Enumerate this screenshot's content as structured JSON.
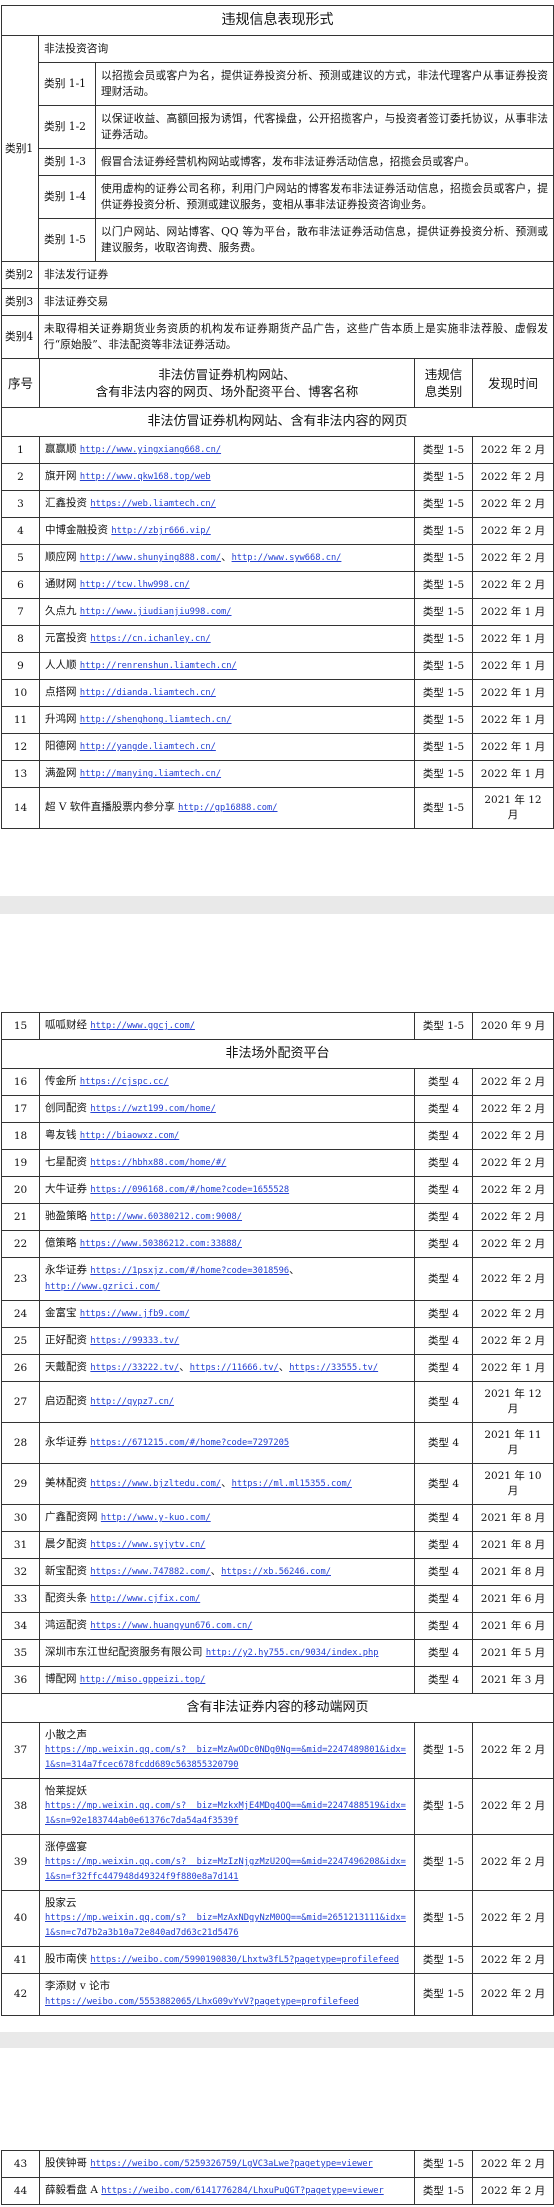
{
  "colors": {
    "link": "#2440d2",
    "border": "#333333",
    "page_gap": "#e9e9e9"
  },
  "forms_table": {
    "title": "违规信息表现形式",
    "category1": {
      "label": "类别1",
      "heading": "非法投资咨询",
      "items": [
        {
          "code": "类别 1-1",
          "desc": "以招揽会员或客户为名，提供证券投资分析、预测或建议的方式，非法代理客户从事证券投资理财活动。"
        },
        {
          "code": "类别 1-2",
          "desc": "以保证收益、高额回报为诱饵，代客操盘，公开招揽客户，与投资者签订委托协议，从事非法证券活动。"
        },
        {
          "code": "类别 1-3",
          "desc": "假冒合法证券经营机构网站或博客，发布非法证券活动信息，招揽会员或客户。"
        },
        {
          "code": "类别 1-4",
          "desc": "使用虚构的证券公司名称，利用门户网站的博客发布非法证券活动信息，招揽会员或客户，提供证券投资分析、预测或建议服务，变相从事非法证券投资咨询业务。"
        },
        {
          "code": "类别 1-5",
          "desc": "以门户网站、网站博客、QQ 等为平台，散布非法证券活动信息，提供证券投资分析、预测或建议服务，收取咨询费、服务费。"
        }
      ]
    },
    "others": [
      {
        "label": "类别2",
        "desc": "非法发行证券"
      },
      {
        "label": "类别3",
        "desc": "非法证券交易"
      },
      {
        "label": "类别4",
        "desc": "未取得相关证券期货业务资质的机构发布证券期货产品广告，这些广告本质上是实施非法荐股、虚假发行“原始股”、非法配资等非法证券活动。"
      }
    ]
  },
  "list_table": {
    "headers": {
      "no": "序号",
      "name_lines": [
        "非法仿冒证券机构网站、",
        "含有非法内容的网页、场外配资平台、博客名称"
      ],
      "category": "违规信息类别",
      "date": "发现时间"
    },
    "link_separator": "、",
    "sections": [
      {
        "title": "非法仿冒证券机构网站、含有非法内容的网页",
        "rows": [
          {
            "no": "1",
            "name": "赢赢顺",
            "links": [
              "http://www.yingxiang668.cn/"
            ],
            "category": "类型 1-5",
            "date": "2022 年 2 月"
          },
          {
            "no": "2",
            "name": "旗开网",
            "links": [
              "http://www.qkw168.top/web"
            ],
            "category": "类型 1-5",
            "date": "2022 年 2 月"
          },
          {
            "no": "3",
            "name": "汇鑫投资",
            "links": [
              "https://web.liamtech.cn/"
            ],
            "category": "类型 1-5",
            "date": "2022 年 2 月"
          },
          {
            "no": "4",
            "name": "中博金融投资",
            "links": [
              "http://zbjr666.vip/"
            ],
            "category": "类型 1-5",
            "date": "2022 年 2 月"
          },
          {
            "no": "5",
            "name": "顺应网",
            "links": [
              "http://www.shunying888.com/",
              "http://www.syw668.cn/"
            ],
            "category": "类型 1-5",
            "date": "2022 年 2 月"
          },
          {
            "no": "6",
            "name": "通财网",
            "links": [
              "http://tcw.lhw998.cn/"
            ],
            "category": "类型 1-5",
            "date": "2022 年 2 月"
          },
          {
            "no": "7",
            "name": "久点九",
            "links": [
              "http://www.jiudianjiu998.com/"
            ],
            "category": "类型 1-5",
            "date": "2022 年 1 月"
          },
          {
            "no": "8",
            "name": "元富投资",
            "links": [
              "https://cn.ichanley.cn/"
            ],
            "category": "类型 1-5",
            "date": "2022 年 1 月"
          },
          {
            "no": "9",
            "name": "人人顺",
            "links": [
              "http://renrenshun.liamtech.cn/"
            ],
            "category": "类型 1-5",
            "date": "2022 年 1 月"
          },
          {
            "no": "10",
            "name": "点搭网",
            "links": [
              "http://dianda.liamtech.cn/"
            ],
            "category": "类型 1-5",
            "date": "2022 年 1 月"
          },
          {
            "no": "11",
            "name": "升鸿网",
            "links": [
              "http://shenghong.liamtech.cn/"
            ],
            "category": "类型 1-5",
            "date": "2022 年 1 月"
          },
          {
            "no": "12",
            "name": "阳德网",
            "links": [
              "http://yangde.liamtech.cn/"
            ],
            "category": "类型 1-5",
            "date": "2022 年 1 月"
          },
          {
            "no": "13",
            "name": "满盈网",
            "links": [
              "http://manying.liamtech.cn/"
            ],
            "category": "类型 1-5",
            "date": "2022 年 1 月"
          },
          {
            "no": "14",
            "name": "超 V 软件直播股票内参分享",
            "links": [
              "http://gp16888.com/"
            ],
            "category": "类型 1-5",
            "date": "2021 年 12 月"
          },
          {
            "no": "15",
            "name": "呱呱财经",
            "links": [
              "http://www.ggcj.com/"
            ],
            "category": "类型 1-5",
            "date": "2020 年 9 月"
          }
        ]
      },
      {
        "title": "非法场外配资平台",
        "rows": [
          {
            "no": "16",
            "name": "传金所",
            "links": [
              "https://cjspc.cc/"
            ],
            "category": "类型 4",
            "date": "2022 年 2 月"
          },
          {
            "no": "17",
            "name": "创同配资",
            "links": [
              "https://wzt199.com/home/"
            ],
            "category": "类型 4",
            "date": "2022 年 2 月"
          },
          {
            "no": "18",
            "name": "粤友钱",
            "links": [
              "http://biaowxz.com/"
            ],
            "category": "类型 4",
            "date": "2022 年 2 月"
          },
          {
            "no": "19",
            "name": "七星配资",
            "links": [
              "https://hbhx88.com/home/#/"
            ],
            "category": "类型 4",
            "date": "2022 年 2 月"
          },
          {
            "no": "20",
            "name": "大牛证券",
            "links": [
              "https://096168.com/#/home?code=1655528"
            ],
            "category": "类型 4",
            "date": "2022 年 2 月"
          },
          {
            "no": "21",
            "name": "驰盈策略",
            "links": [
              "http://www.60380212.com:9008/"
            ],
            "category": "类型 4",
            "date": "2022 年 2 月"
          },
          {
            "no": "22",
            "name": "億策略",
            "links": [
              "https://www.50386212.com:33888/"
            ],
            "category": "类型 4",
            "date": "2022 年 2 月"
          },
          {
            "no": "23",
            "name": "永华证券",
            "links": [
              "https://1psxjz.com/#/home?code=3018596",
              "http://www.gzrici.com/"
            ],
            "category": "类型 4",
            "date": "2022 年 2 月"
          },
          {
            "no": "24",
            "name": "金富宝",
            "links": [
              "https://www.jfb9.com/"
            ],
            "category": "类型 4",
            "date": "2022 年 2 月"
          },
          {
            "no": "25",
            "name": "正好配资",
            "links": [
              "https://99333.tv/"
            ],
            "category": "类型 4",
            "date": "2022 年 2 月"
          },
          {
            "no": "26",
            "name": "天戴配资",
            "links": [
              "https://33222.tv/",
              "https://11666.tv/",
              "https://33555.tv/"
            ],
            "category": "类型 4",
            "date": "2022 年 1 月"
          },
          {
            "no": "27",
            "name": "启迈配资",
            "links": [
              "http://qypz7.cn/"
            ],
            "category": "类型 4",
            "date": "2021 年 12 月"
          },
          {
            "no": "28",
            "name": "永华证券",
            "links": [
              "https://671215.com/#/home?code=7297205"
            ],
            "category": "类型 4",
            "date": "2021 年 11 月"
          },
          {
            "no": "29",
            "name": "美林配资",
            "links": [
              "https://www.bjzltedu.com/",
              "https://ml.ml15355.com/"
            ],
            "category": "类型 4",
            "date": "2021 年 10 月"
          },
          {
            "no": "30",
            "name": "广鑫配资网",
            "links": [
              "http://www.y-kuo.com/"
            ],
            "category": "类型 4",
            "date": "2021 年 8 月"
          },
          {
            "no": "31",
            "name": "晨夕配资",
            "links": [
              "https://www.syjytv.cn/"
            ],
            "category": "类型 4",
            "date": "2021 年 8 月"
          },
          {
            "no": "32",
            "name": "新宝配资",
            "links": [
              "https://www.747882.com/",
              "https://xb.56246.com/"
            ],
            "category": "类型 4",
            "date": "2021 年 8 月"
          },
          {
            "no": "33",
            "name": "配资头条",
            "links": [
              "http://www.cjfix.com/"
            ],
            "category": "类型 4",
            "date": "2021 年 6 月"
          },
          {
            "no": "34",
            "name": "鸿运配资",
            "links": [
              "https://www.huangyun676.com.cn/"
            ],
            "category": "类型 4",
            "date": "2021 年 6 月"
          },
          {
            "no": "35",
            "name": "深圳市东江世纪配资服务有限公司",
            "links": [
              "http://y2.hy755.cn/9034/index.php"
            ],
            "category": "类型 4",
            "date": "2021 年 5 月"
          },
          {
            "no": "36",
            "name": "博配网",
            "links": [
              "http://miso.gppeizi.top/"
            ],
            "category": "类型 4",
            "date": "2021 年 3 月"
          }
        ]
      },
      {
        "title": "含有非法证券内容的移动端网页",
        "rows": [
          {
            "no": "37",
            "name": "小散之声",
            "links": [
              "https://mp.weixin.qq.com/s?__biz=MzAwODc0NDg0Ng==&mid=2247489801&idx=1&sn=314a7fcec678fcdd689c563855320790"
            ],
            "category": "类型 1-5",
            "date": "2022 年 2 月"
          },
          {
            "no": "38",
            "name": "怡莱捉妖",
            "links": [
              "https://mp.weixin.qq.com/s?__biz=MzkxMjE4MDg4OQ==&mid=2247488519&idx=1&sn=92e183744ab0e61376c7da54a4f3539f"
            ],
            "category": "类型 1-5",
            "date": "2022 年 2 月"
          },
          {
            "no": "39",
            "name": "涨停盛宴",
            "links": [
              "https://mp.weixin.qq.com/s?__biz=MzIzNjgzMzU2OQ==&mid=2247496208&idx=1&sn=f32ffc447948d49324f9f880e8a7d141"
            ],
            "category": "类型 1-5",
            "date": "2022 年 2 月"
          },
          {
            "no": "40",
            "name": "股家云",
            "links": [
              "https://mp.weixin.qq.com/s?__biz=MzAxNDgyNzM0OQ==&mid=2651213111&idx=1&sn=c7d7b2a3b10a72e840ad7d63c21d5476"
            ],
            "category": "类型 1-5",
            "date": "2022 年 2 月"
          },
          {
            "no": "41",
            "name": "股市南侠",
            "links": [
              "https://weibo.com/5990190830/Lhxtw3fL5?pagetype=profilefeed"
            ],
            "category": "类型 1-5",
            "date": "2022 年 2 月"
          },
          {
            "no": "42",
            "name": "李添财 v 论市",
            "links": [
              "https://weibo.com/5553882065/LhxG09vYvV?pagetype=profilefeed"
            ],
            "category": "类型 1-5",
            "date": "2022 年 2 月"
          },
          {
            "no": "43",
            "name": "股侠钟哥",
            "links": [
              "https://weibo.com/5259326759/LgVC3aLwe?pagetype=viewer"
            ],
            "category": "类型 1-5",
            "date": "2022 年 2 月"
          },
          {
            "no": "44",
            "name": "薛毅看盘 A",
            "links": [
              "https://weibo.com/6141776284/LhxuPuQGT?pagetype=viewer"
            ],
            "category": "类型 1-5",
            "date": "2022 年 2 月"
          }
        ]
      }
    ]
  }
}
